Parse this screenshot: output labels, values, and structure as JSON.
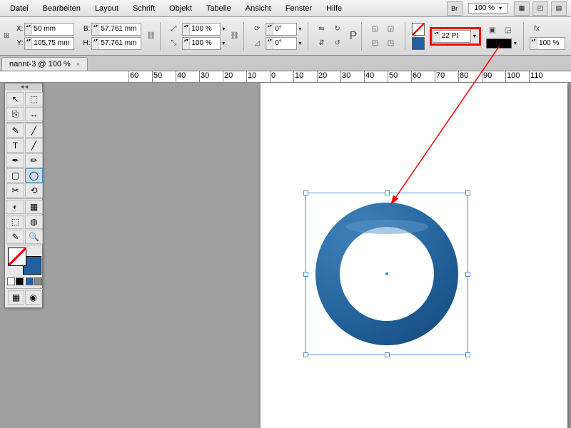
{
  "menu": {
    "items": [
      "Datei",
      "Bearbeiten",
      "Layout",
      "Schrift",
      "Objekt",
      "Tabelle",
      "Ansicht",
      "Fenster",
      "Hilfe"
    ],
    "br": "Br",
    "zoom": "100 %"
  },
  "coords": {
    "x_label": "X:",
    "x": "50 mm",
    "y_label": "Y:",
    "y": "105,75 mm",
    "w_label": "B:",
    "w": "57,761 mm",
    "h_label": "H:",
    "h": "57,761 mm"
  },
  "scale": {
    "x": "100 %",
    "y": "100 %"
  },
  "rotate": {
    "angle": "0°",
    "shear": "0°"
  },
  "stroke": {
    "weight": "22 Pt",
    "pct": "100 %"
  },
  "tab": {
    "title": "nannt-3 @ 100 %"
  },
  "ruler": [
    "60",
    "50",
    "40",
    "30",
    "20",
    "10",
    "0",
    "10",
    "20",
    "30",
    "40",
    "50",
    "60",
    "70",
    "80",
    "90",
    "100",
    "110"
  ],
  "tools": [
    "↖",
    "⬚",
    "⎘",
    "↔",
    "✎",
    "╱",
    "T",
    "╱",
    "✒",
    "✏",
    "▢",
    "◯",
    "✂",
    "⟲",
    "◐",
    "▦",
    "⬚",
    "◍",
    "✎",
    "🔍"
  ]
}
